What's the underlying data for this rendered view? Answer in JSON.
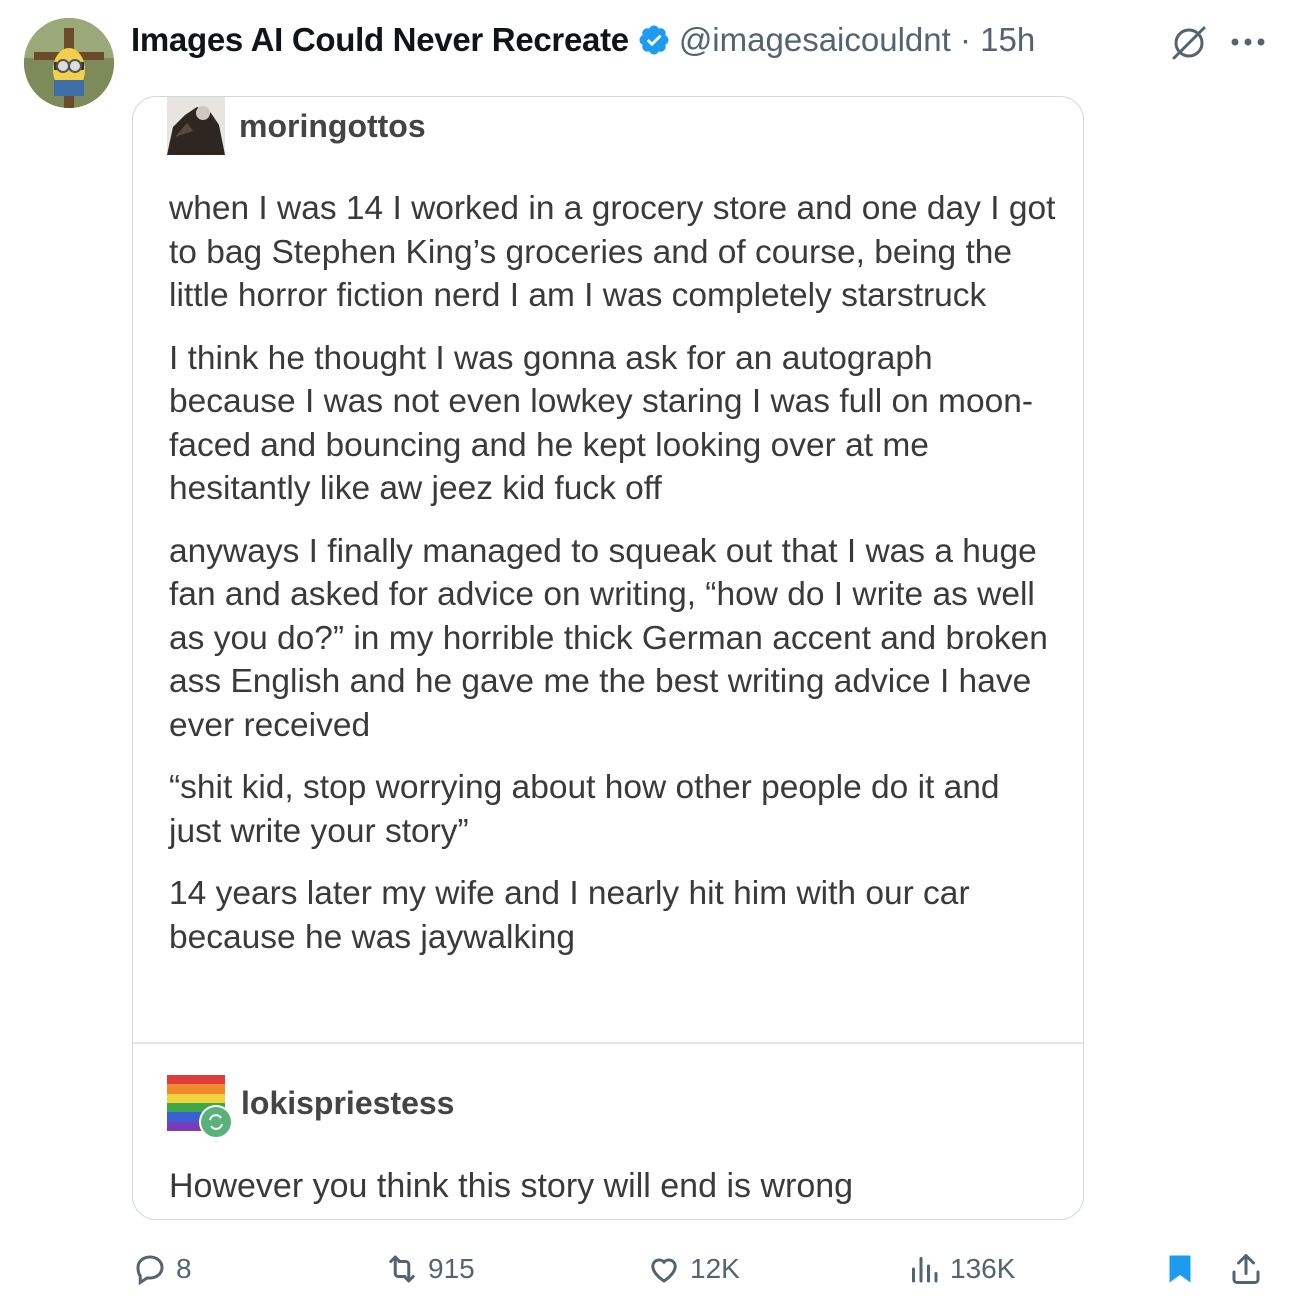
{
  "tweet": {
    "display_name": "Images AI Could Never Recreate",
    "handle_time": "@imagesaicouldnt · 15h",
    "verified_color": "#1d9bf0"
  },
  "embed": {
    "original_user": "moringottos",
    "paragraphs": [
      "when I was 14 I worked in a grocery store and one day I got to bag Stephen King’s groceries and of course, being the little horror fiction nerd I am I was completely starstruck",
      "I think he thought I  was gonna ask for an autograph because I was not even lowkey staring I was full on moon-faced and bouncing and he kept looking over at me hesitantly like aw jeez kid fuck off",
      "anyways I finally managed to squeak out that I was a huge fan and asked for advice on writing, “how do I write as well as you do?” in my horrible thick German accent and broken ass English and he gave me the best writing advice I have ever received",
      "“shit kid, stop worrying about how other people do it and just write your story”",
      "14 years later my wife and I nearly hit him with our car because he was jaywalking"
    ],
    "reblog_user": "lokispriestess",
    "reblog_text": "However you think this story will end is wrong"
  },
  "actions": {
    "replies": "8",
    "reposts": "915",
    "likes": "12K",
    "views": "136K",
    "bookmark_color": "#1d9bf0"
  },
  "icons": [
    "avatar",
    "verified-badge-icon",
    "grok-icon",
    "more-icon",
    "reply-icon",
    "repost-icon",
    "like-icon",
    "views-icon",
    "bookmark-icon",
    "share-icon"
  ]
}
